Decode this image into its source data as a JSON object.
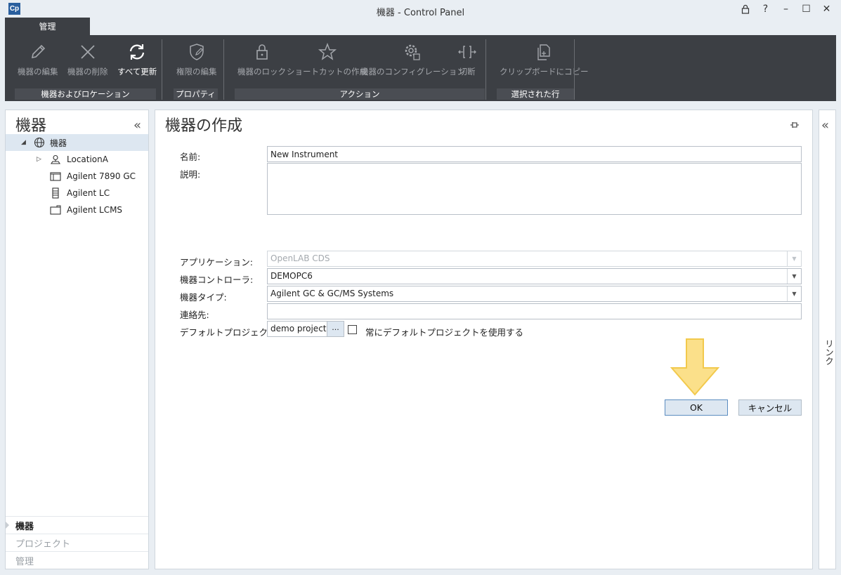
{
  "window": {
    "title": "機器 - Control Panel",
    "logo": "Cp",
    "controls": [
      "lock-icon",
      "help-icon",
      "minimize-icon",
      "maximize-icon",
      "close-icon"
    ],
    "help_glyph": "?",
    "minimize_glyph": "–",
    "maximize_glyph": "☐",
    "close_glyph": "✕"
  },
  "ribbon": {
    "tab": "管理",
    "groups": [
      {
        "label": "機器およびロケーション",
        "buttons": [
          {
            "label": "機器の編集",
            "icon": "pencil-icon",
            "enabled": false
          },
          {
            "label": "機器の削除",
            "icon": "x-icon",
            "enabled": false
          },
          {
            "label": "すべて更新",
            "icon": "refresh-icon",
            "enabled": true
          }
        ]
      },
      {
        "label": "プロパティ",
        "buttons": [
          {
            "label": "権限の編集",
            "icon": "shield-pencil-icon",
            "enabled": false
          }
        ]
      },
      {
        "label": "アクション",
        "buttons": [
          {
            "label": "機器のロック",
            "icon": "lock-icon",
            "enabled": false
          },
          {
            "label": "ショートカットの作成",
            "icon": "star-icon",
            "enabled": false
          },
          {
            "label": "機器のコンフィグレーション",
            "icon": "gear-icon",
            "enabled": false
          },
          {
            "label": "切断",
            "icon": "disconnect-icon",
            "enabled": false
          }
        ]
      },
      {
        "label": "選択された行",
        "buttons": [
          {
            "label": "クリップボードにコピー",
            "icon": "copy-icon",
            "enabled": false
          }
        ]
      }
    ]
  },
  "left_panel": {
    "title": "機器",
    "collapse_glyph": "«",
    "tree": [
      {
        "label": "機器",
        "icon": "globe-icon",
        "expanded": true,
        "selected": true,
        "level": 0
      },
      {
        "label": "LocationA",
        "icon": "location-icon",
        "expandable": true,
        "level": 1
      },
      {
        "label": "Agilent 7890 GC",
        "icon": "gc-instrument-icon",
        "level": 1
      },
      {
        "label": "Agilent LC",
        "icon": "lc-instrument-icon",
        "level": 1
      },
      {
        "label": "Agilent LCMS",
        "icon": "lcms-instrument-icon",
        "level": 1
      }
    ],
    "nav": [
      {
        "label": "機器",
        "active": true
      },
      {
        "label": "プロジェクト",
        "active": false
      },
      {
        "label": "管理",
        "active": false
      }
    ]
  },
  "form": {
    "title": "機器の作成",
    "name_label": "名前:",
    "name_value": "New Instrument",
    "description_label": "説明:",
    "description_value": "",
    "application_label": "アプリケーション:",
    "application_value": "OpenLAB CDS",
    "controller_label": "機器コントローラ:",
    "controller_value": "DEMOPC6",
    "type_label": "機器タイプ:",
    "type_value": "Agilent GC & GC/MS Systems",
    "contact_label": "連絡先:",
    "contact_value": "",
    "default_project_label": "デフォルトプロジェクト:",
    "default_project_value": "demo project",
    "browse_label": "...",
    "always_use_label": "常にデフォルトプロジェクトを使用する",
    "always_use_checked": false,
    "ok_label": "OK",
    "cancel_label": "キャンセル"
  },
  "right_panel": {
    "label": "リンク",
    "collapse_glyph": "«"
  },
  "colors": {
    "ribbon_bg": "#3c3f44",
    "ribbon_disabled_text": "#a3a6ab",
    "selection_bg": "#dde7f1",
    "hint_arrow_fill": "#fbe08a",
    "hint_arrow_stroke": "#f2c94c"
  }
}
